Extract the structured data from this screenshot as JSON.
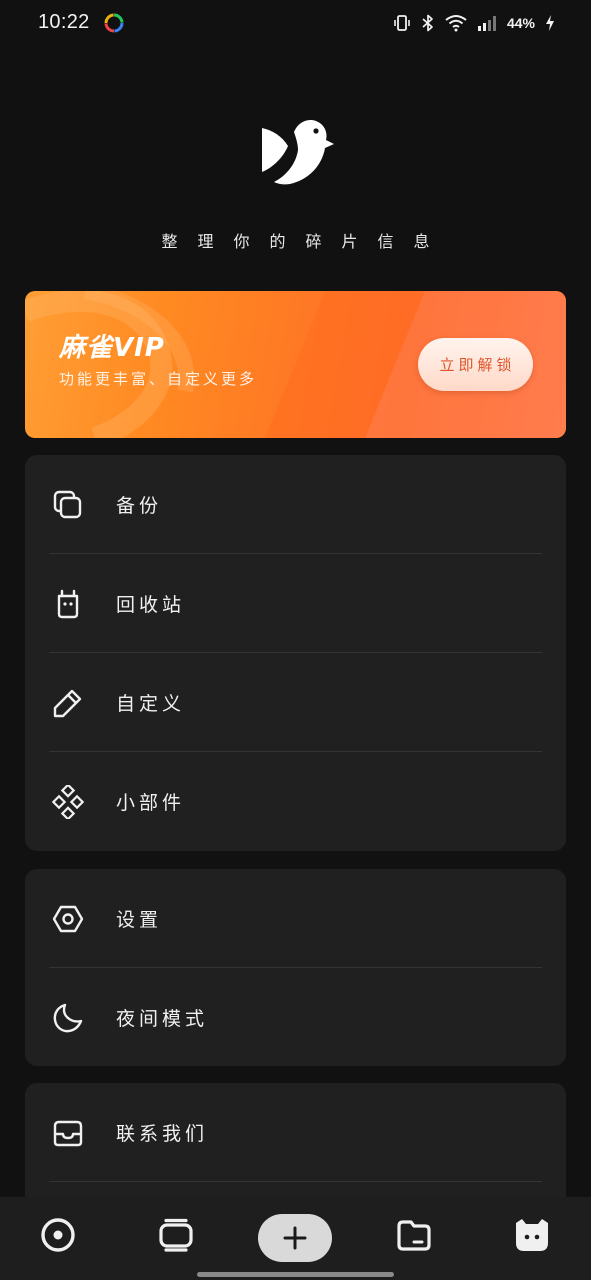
{
  "status_bar": {
    "time": "10:22",
    "battery": "44%",
    "icons": [
      "vibrate-icon",
      "bluetooth-icon",
      "wifi-icon",
      "signal-icon",
      "charging-icon"
    ]
  },
  "app": {
    "tagline": "整理你的碎片信息"
  },
  "vip": {
    "title": "麻雀VIP",
    "subtitle": "功能更丰富、自定义更多",
    "button_label": "立即解锁",
    "colors": {
      "start": "#ff9e35",
      "end": "#ff7f5c",
      "button_text": "#e0532a"
    }
  },
  "menu_groups": [
    {
      "items": [
        {
          "label": "备份",
          "icon": "backup-icon"
        },
        {
          "label": "回收站",
          "icon": "trash-icon"
        },
        {
          "label": "自定义",
          "icon": "pencil-icon"
        },
        {
          "label": "小部件",
          "icon": "widget-icon"
        }
      ]
    },
    {
      "items": [
        {
          "label": "设置",
          "icon": "settings-icon"
        },
        {
          "label": "夜间模式",
          "icon": "moon-icon"
        }
      ]
    },
    {
      "items": [
        {
          "label": "联系我们",
          "icon": "inbox-icon"
        }
      ]
    }
  ],
  "bottom_nav": {
    "items": [
      "record-icon",
      "cards-icon",
      "add-icon",
      "folder-icon",
      "profile-icon"
    ]
  },
  "colors": {
    "background": "#111111",
    "card": "#202020",
    "divider": "#343434",
    "nav_background": "#1e1e1e"
  }
}
